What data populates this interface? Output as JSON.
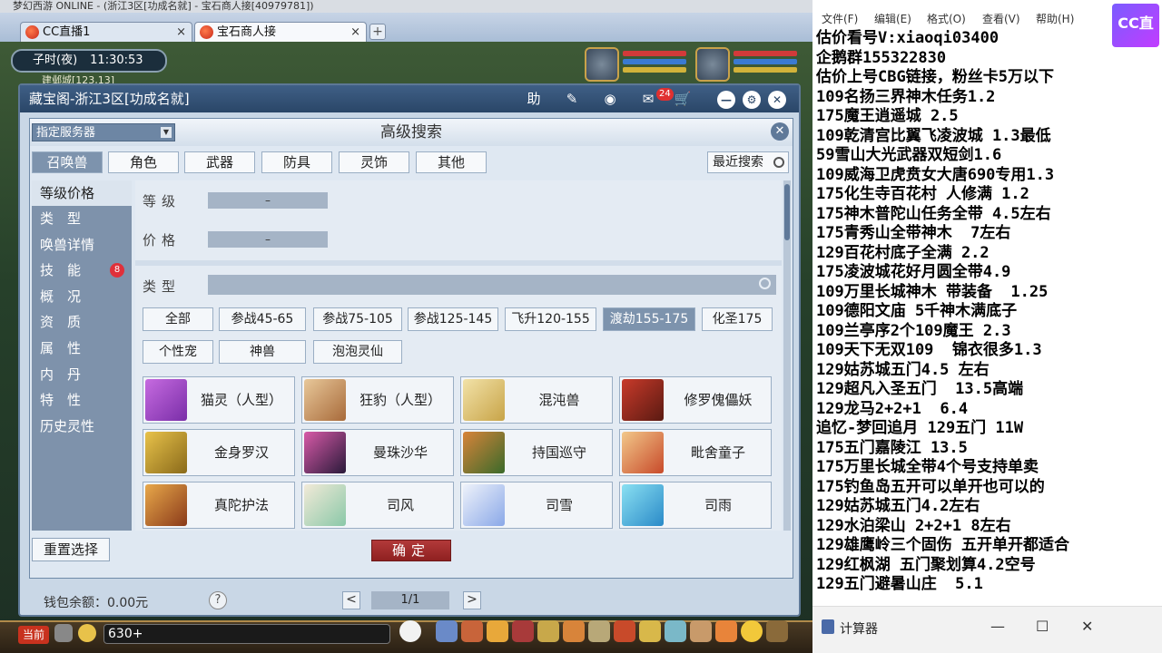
{
  "window": {
    "title": "梦幻西游 ONLINE - (浙江3区[功成名就] - 宝石商人接[40979781])"
  },
  "browser_tabs": [
    {
      "label": "CC直播1"
    },
    {
      "label": "宝石商人接"
    }
  ],
  "game_hud": {
    "time_period": "子时(夜)",
    "time": "11:30:53",
    "location": "建邺城[123,13]"
  },
  "cbg": {
    "header_title": "藏宝阁-浙江3区[功成名就]",
    "help_label": "助",
    "cart_badge": "24"
  },
  "dialog": {
    "server_select": "指定服务器",
    "title": "高级搜索",
    "category_tabs": [
      "召唤兽",
      "角色",
      "武器",
      "防具",
      "灵饰",
      "其他"
    ],
    "recent_search": "最近搜索",
    "sidebar_items": [
      {
        "label": "等级价格"
      },
      {
        "label": "类　型"
      },
      {
        "label": "唤兽详情"
      },
      {
        "label": "技　能",
        "badge": "8"
      },
      {
        "label": "概　况"
      },
      {
        "label": "资　质"
      },
      {
        "label": "属　性"
      },
      {
        "label": "内　丹"
      },
      {
        "label": "特　性"
      },
      {
        "label": "历史灵性"
      }
    ],
    "fields": {
      "level_label": "等级",
      "level_range": "–",
      "price_label": "价格",
      "price_range": "–",
      "type_label": "类型"
    },
    "type_chips": [
      "全部",
      "参战45-65",
      "参战75-105",
      "参战125-145",
      "飞升120-155",
      "渡劫155-175",
      "化圣175",
      "个性宠",
      "神兽",
      "泡泡灵仙"
    ],
    "pets": [
      "猫灵（人型）",
      "狂豹（人型）",
      "混沌兽",
      "修罗傀儡妖",
      "金身罗汉",
      "曼珠沙华",
      "持国巡守",
      "毗舍童子",
      "真陀护法",
      "司风",
      "司雪",
      "司雨"
    ],
    "reset_label": "重置选择",
    "ok_label": "确定"
  },
  "footer": {
    "wallet": "钱包余额：0.00元",
    "help": "?",
    "prev": "<",
    "page": "1/1",
    "next": ">"
  },
  "gamebar": {
    "dangqian": "当前",
    "chat_value": "630+"
  },
  "notepad": {
    "menu": [
      "文件(F)",
      "编辑(E)",
      "格式(O)",
      "查看(V)",
      "帮助(H)"
    ],
    "lines": [
      "估价看号V:xiaoqi03400",
      "企鹅群155322830",
      "估价上号CBG链接，粉丝卡5万以下",
      "109名扬三界神木任务1.2",
      "175魔王逍遥城 2.5",
      "109乾清宫比翼飞凌波城 1.3最低",
      "59雪山大光武器双短剑1.6",
      "109威海卫虎贲女大唐690专用1.3",
      "175化生寺百花村 人修满 1.2",
      "175神木普陀山任务全带 4.5左右",
      "175青秀山全带神木  7左右",
      "129百花村底子全满 2.2",
      "175凌波城花好月圆全带4.9",
      "109万里长城神木 带装备  1.25",
      "109德阳文庙 5千神木满底子",
      "109兰亭序2个109魔王 2.3",
      "109天下无双109  锦衣很多1.3",
      "129姑苏城五门4.5 左右",
      "129超凡入圣五门  13.5高端",
      "129龙马2+2+1  6.4",
      "追忆-梦回追月 129五门 11W",
      "175五门嘉陵江 13.5",
      "175万里长城全带4个号支持单卖",
      "175钓鱼岛五开可以单开也可以的",
      "129姑苏城五门4.2左右",
      "129水泊梁山 2+2+1 8左右",
      "129雄鹰岭三个固伤 五开单开都适合",
      "129红枫湖 五门聚划算4.2空号",
      "129五门避暑山庄  5.1"
    ]
  },
  "overlay": {
    "logo_text": "CC直播"
  },
  "calculator": {
    "title": "计算器",
    "minimize": "—",
    "maximize": "☐",
    "close": "✕"
  },
  "colors": {
    "accent": "#7d93ad",
    "header": "#2a4668",
    "confirm": "#a52c2c",
    "badge": "#e0303a"
  }
}
